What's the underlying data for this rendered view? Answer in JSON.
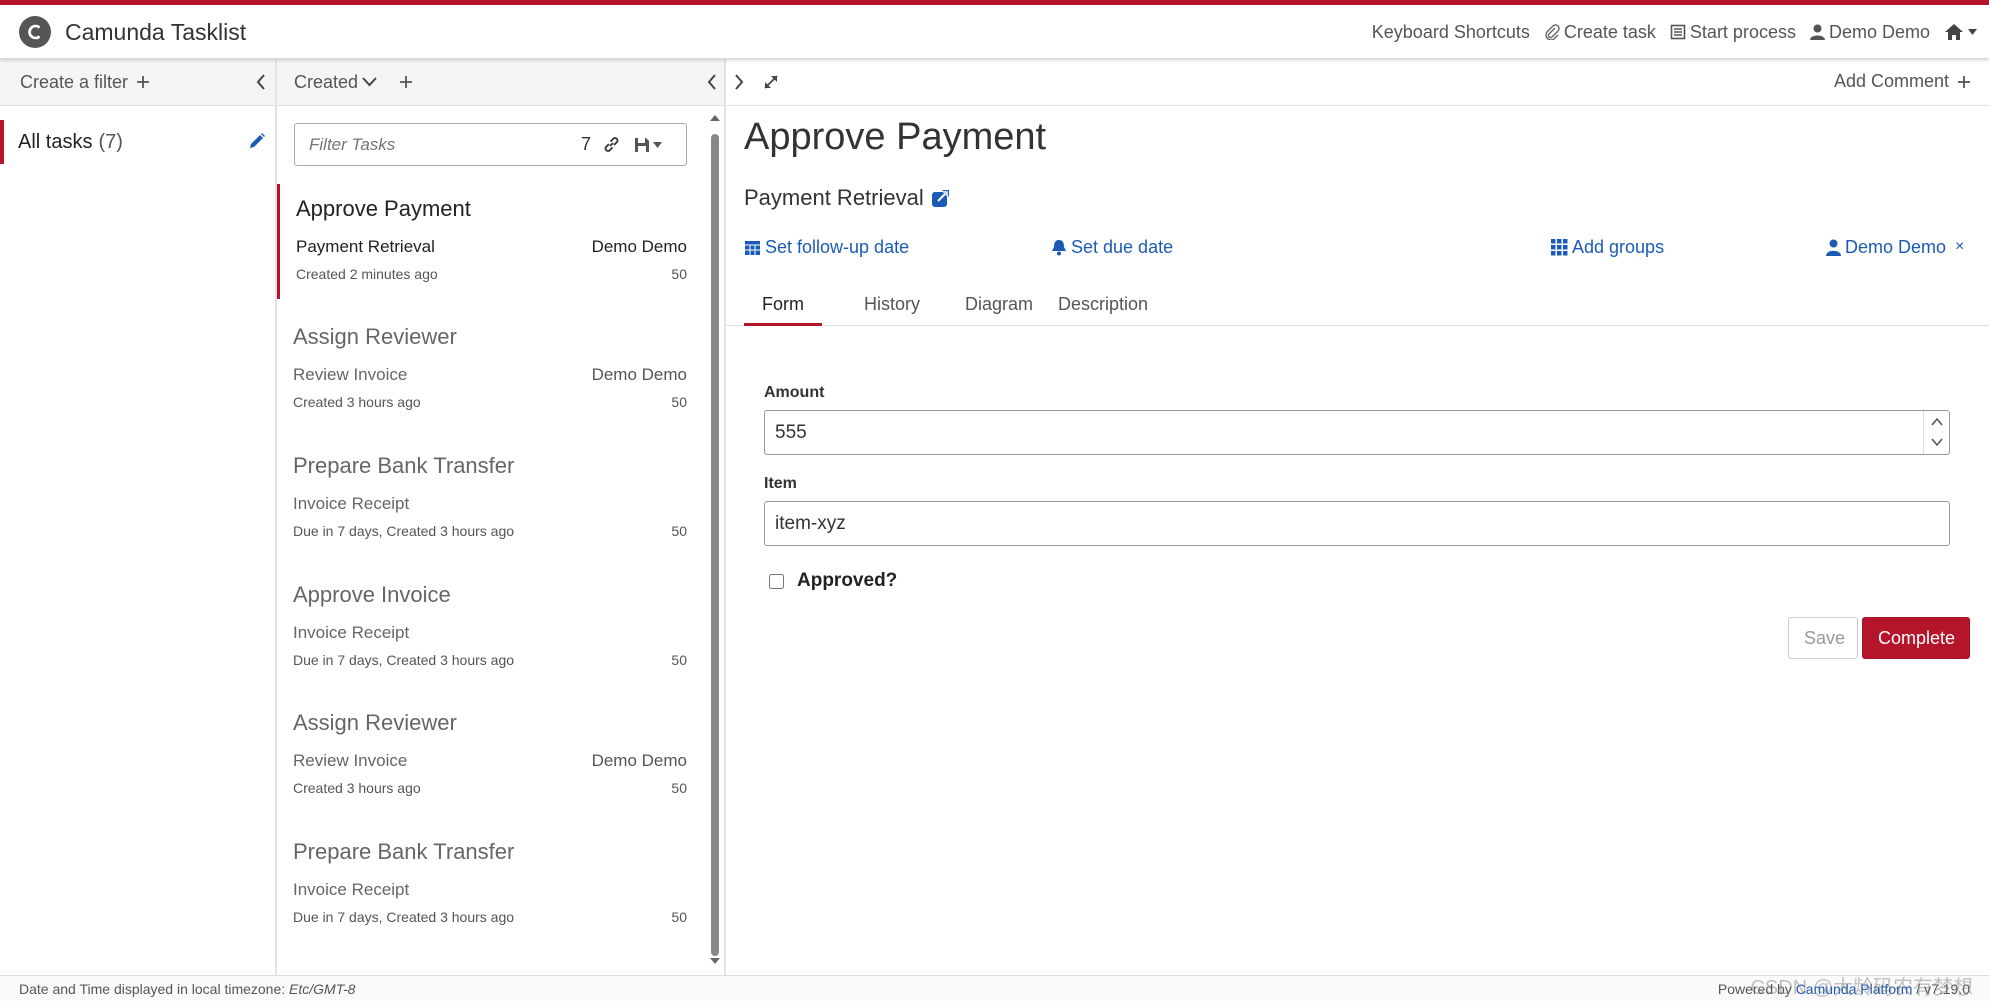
{
  "app": {
    "title": "Camunda Tasklist"
  },
  "topnav": {
    "keyboard_shortcuts": "Keyboard Shortcuts",
    "create_task": "Create task",
    "start_process": "Start process",
    "user": "Demo Demo"
  },
  "filters": {
    "header_label": "Create a filter",
    "items": [
      {
        "label": "All tasks",
        "count": "(7)"
      }
    ]
  },
  "tasklist": {
    "sort_label": "Created",
    "search_placeholder": "Filter Tasks",
    "count": "7",
    "tasks": [
      {
        "name": "Approve Payment",
        "process": "Payment Retrieval",
        "assignee": "Demo Demo",
        "created": "Created 2 minutes ago",
        "priority": "50"
      },
      {
        "name": "Assign Reviewer",
        "process": "Review Invoice",
        "assignee": "Demo Demo",
        "created": "Created 3 hours ago",
        "priority": "50"
      },
      {
        "name": "Prepare Bank Transfer",
        "process": "Invoice Receipt",
        "assignee": "",
        "created": "Due in 7 days, Created 3 hours ago",
        "priority": "50"
      },
      {
        "name": "Approve Invoice",
        "process": "Invoice Receipt",
        "assignee": "",
        "created": "Due in 7 days, Created 3 hours ago",
        "priority": "50"
      },
      {
        "name": "Assign Reviewer",
        "process": "Review Invoice",
        "assignee": "Demo Demo",
        "created": "Created 3 hours ago",
        "priority": "50"
      },
      {
        "name": "Prepare Bank Transfer",
        "process": "Invoice Receipt",
        "assignee": "",
        "created": "Due in 7 days, Created 3 hours ago",
        "priority": "50"
      }
    ]
  },
  "detail": {
    "add_comment": "Add Comment",
    "title": "Approve Payment",
    "process": "Payment Retrieval",
    "actions": {
      "follow_up": "Set follow-up date",
      "due_date": "Set due date",
      "groups": "Add groups",
      "assignee": "Demo Demo",
      "remove_assignee": "×"
    },
    "tabs": [
      "Form",
      "History",
      "Diagram",
      "Description"
    ],
    "form": {
      "amount_label": "Amount",
      "amount_value": "555",
      "item_label": "Item",
      "item_value": "item-xyz",
      "approved_label": "Approved?",
      "approved_checked": false
    },
    "buttons": {
      "save": "Save",
      "complete": "Complete"
    }
  },
  "footer": {
    "timezone_text": "Date and Time displayed in local timezone:",
    "timezone": "Etc/GMT-8",
    "powered_by": "Powered by",
    "platform_link": "Camunda Platform",
    "version": "/ v7.19.0"
  },
  "watermark": "CSDN @大龄码农有梦想",
  "colors": {
    "accent": "#b5152b",
    "link": "#1c5bb5"
  }
}
